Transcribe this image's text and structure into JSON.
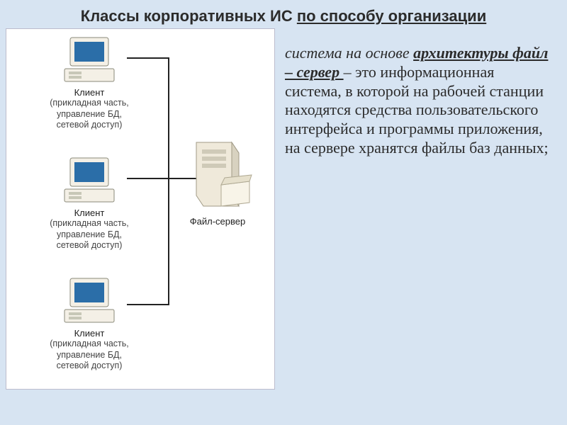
{
  "title": {
    "prefix": "Классы корпоративных ИС ",
    "underlined": "по способу организации"
  },
  "diagram": {
    "client_label": "Клиент",
    "client_sub": "(прикладная часть,\nуправление БД,\nсетевой доступ)",
    "server_label": "Файл-сервер"
  },
  "description": {
    "lead": "система на основе ",
    "arch": "архитектуры файл – сервер ",
    "body": "– это информационная система, в которой на рабочей станции находятся средства пользовательского интерфейса и программы приложения, на сервере хранятся файлы баз данных;"
  }
}
